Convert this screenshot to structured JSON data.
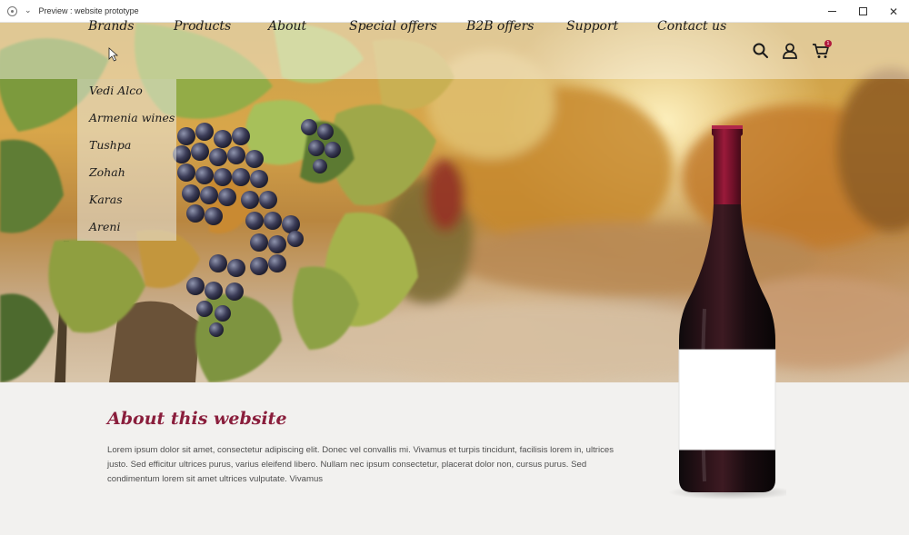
{
  "window": {
    "title": "Preview : website prototype"
  },
  "nav": {
    "items": [
      {
        "label": "Brands"
      },
      {
        "label": "Products"
      },
      {
        "label": "About"
      },
      {
        "label": "Special offers"
      },
      {
        "label": "B2B offers"
      },
      {
        "label": "Support"
      },
      {
        "label": "Contact us"
      }
    ],
    "icons": [
      "search-icon",
      "user-icon",
      "cart-icon"
    ],
    "cart_count": "1"
  },
  "brands_dropdown": {
    "items": [
      "Vedi Alco",
      "Armenia wines",
      "Tushpa",
      "Zohah",
      "Karas",
      "Areni"
    ]
  },
  "about": {
    "title": "About this website",
    "body": "Lorem ipsum dolor sit amet, consectetur adipiscing elit. Donec vel convallis mi. Vivamus et turpis tincidunt, facilisis lorem in, ultrices justo. Sed efficitur ultrices purus, varius eleifend libero. Nullam nec ipsum consectetur, placerat dolor non, cursus purus. Sed condimentum lorem sit amet ultrices vulputate. Vivamus"
  },
  "colors": {
    "accent": "#8a1e3c",
    "badge": "#b0183c",
    "page_bg": "#f2f1ef"
  }
}
